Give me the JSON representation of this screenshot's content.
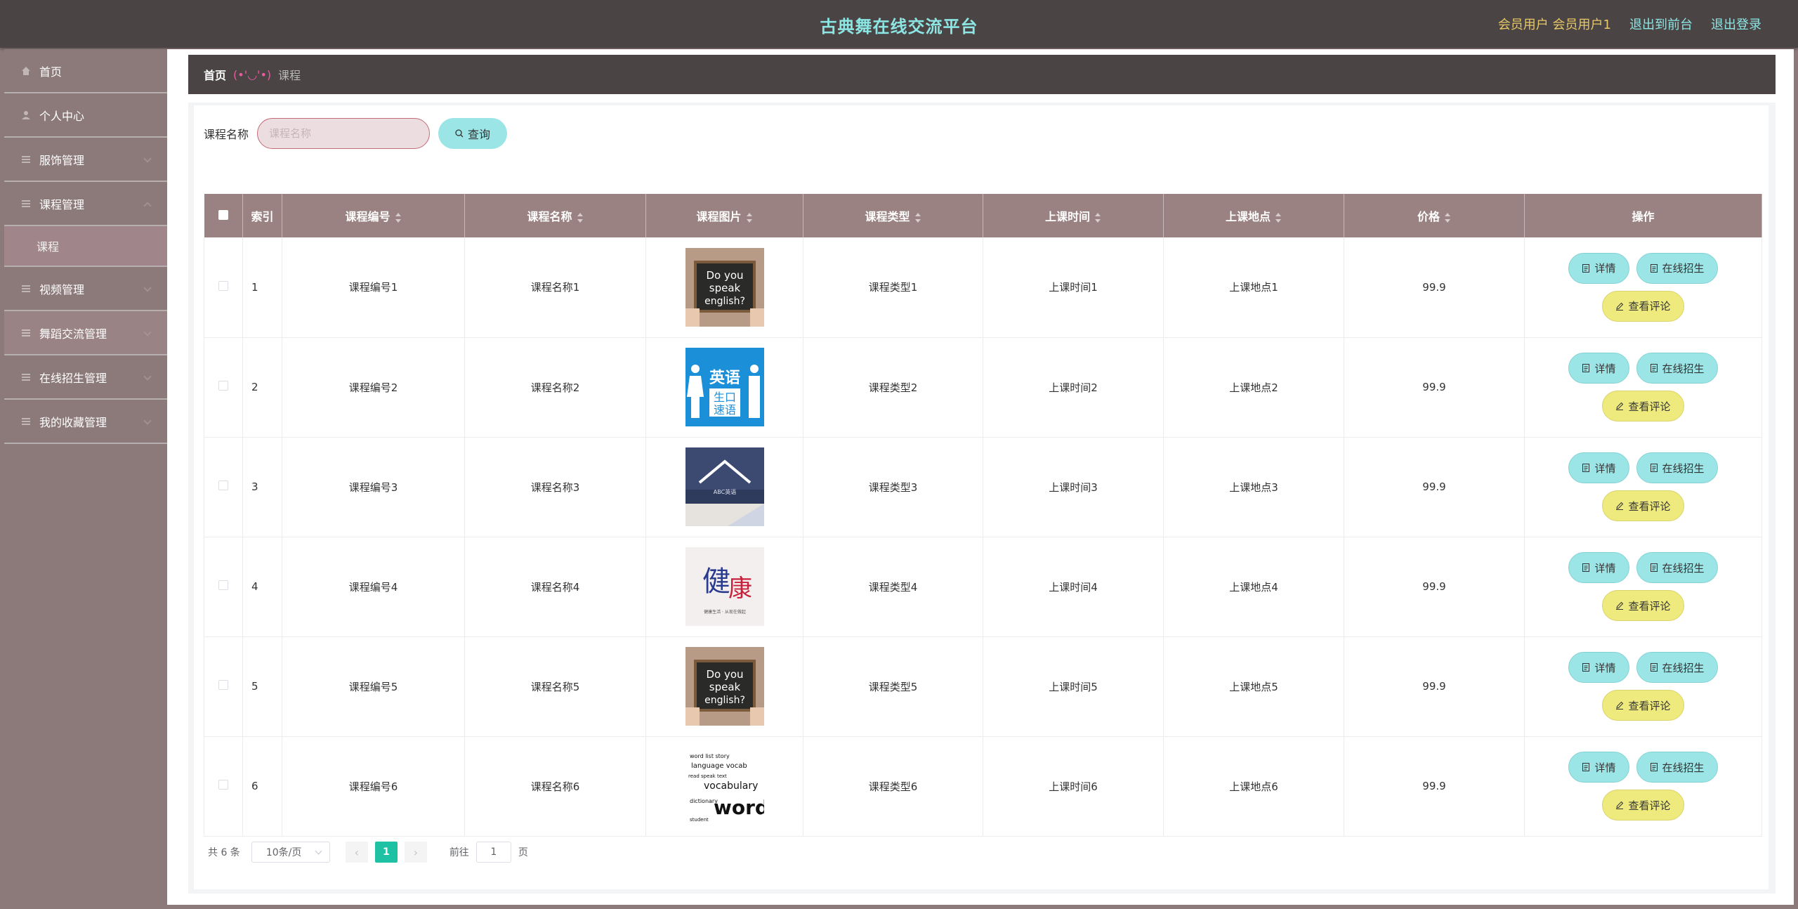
{
  "header": {
    "title": "古典舞在线交流平台",
    "user": "会员用户 会员用户1",
    "back_link": "退出到前台",
    "logout_link": "退出登录"
  },
  "sidebar": {
    "items": [
      {
        "label": "首页",
        "icon": "home-icon"
      },
      {
        "label": "个人中心",
        "icon": "user-icon"
      },
      {
        "label": "服饰管理",
        "icon": "menu-icon"
      },
      {
        "label": "课程管理",
        "icon": "menu-icon"
      },
      {
        "label": "课程",
        "icon": ""
      },
      {
        "label": "视频管理",
        "icon": "menu-icon"
      },
      {
        "label": "舞蹈交流管理",
        "icon": "menu-icon"
      },
      {
        "label": "在线招生管理",
        "icon": "menu-icon"
      },
      {
        "label": "我的收藏管理",
        "icon": "menu-icon"
      }
    ]
  },
  "breadcrumb": {
    "home": "首页",
    "separator": "(•'◡'•)",
    "current": "课程"
  },
  "search": {
    "label": "课程名称",
    "placeholder": "课程名称",
    "button": "查询"
  },
  "table": {
    "headers": [
      "索引",
      "课程编号",
      "课程名称",
      "课程图片",
      "课程类型",
      "上课时间",
      "上课地点",
      "价格",
      "操作"
    ],
    "rows": [
      {
        "index": "1",
        "code": "课程编号1",
        "name": "课程名称1",
        "image": "do-you-speak-english-image",
        "type": "课程类型1",
        "time": "上课时间1",
        "place": "上课地点1",
        "price": "99.9"
      },
      {
        "index": "2",
        "code": "课程编号2",
        "name": "课程名称2",
        "image": "english-speaking-poster-image",
        "type": "课程类型2",
        "time": "上课时间2",
        "place": "上课地点2",
        "price": "99.9"
      },
      {
        "index": "3",
        "code": "课程编号3",
        "name": "课程名称3",
        "image": "classroom-writing-image",
        "type": "课程类型3",
        "time": "上课时间3",
        "place": "上课地点3",
        "price": "99.9"
      },
      {
        "index": "4",
        "code": "课程编号4",
        "name": "课程名称4",
        "image": "calligraphy-poster-image",
        "type": "课程类型4",
        "time": "上课时间4",
        "place": "上课地点4",
        "price": "99.9"
      },
      {
        "index": "5",
        "code": "课程编号5",
        "name": "课程名称5",
        "image": "do-you-speak-english-image",
        "type": "课程类型5",
        "time": "上课时间5",
        "place": "上课地点5",
        "price": "99.9"
      },
      {
        "index": "6",
        "code": "课程编号6",
        "name": "课程名称6",
        "image": "vocabulary-words-image",
        "type": "课程类型6",
        "time": "上课时间6",
        "place": "上课地点6",
        "price": "99.9"
      }
    ],
    "actions": {
      "detail": "详情",
      "enroll": "在线招生",
      "comments": "查看评论"
    }
  },
  "pagination": {
    "total": "共 6 条",
    "page_size": "10条/页",
    "current_page": "1",
    "goto_label": "前往",
    "goto_value": "1",
    "goto_unit": "页"
  },
  "colors": {
    "header_bg": "#4a4445",
    "title": "#8ce6e3",
    "user_text": "#e8c866",
    "sidebar_bg": "#8c7a7b",
    "table_header": "#9a8282",
    "cyan_button": "#9ce5e6",
    "yellow_button": "#eeea7e",
    "active_page": "#1ec1a4"
  }
}
